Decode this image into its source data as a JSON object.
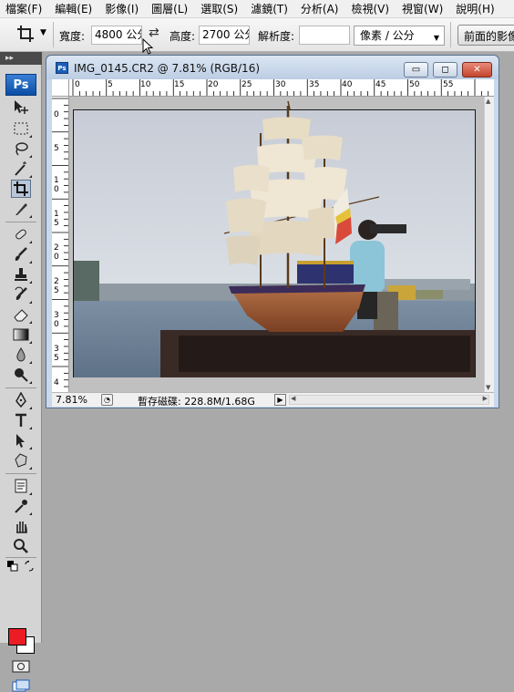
{
  "menubar": {
    "items": [
      "檔案(F)",
      "編輯(E)",
      "影像(I)",
      "圖層(L)",
      "選取(S)",
      "濾鏡(T)",
      "分析(A)",
      "檢視(V)",
      "視窗(W)",
      "說明(H)"
    ]
  },
  "options": {
    "width_label": "寬度:",
    "width_value": "4800 公分",
    "height_label": "高度:",
    "height_value": "2700 公分",
    "resolution_label": "解析度:",
    "resolution_value": "",
    "unit_select": "像素 / 公分",
    "front_image_button": "前面的影像"
  },
  "toolbox": {
    "logo": "Ps"
  },
  "document": {
    "title": "IMG_0145.CR2 @ 7.81% (RGB/16)",
    "icon_text": "Ps",
    "ruler_top_labels": [
      "0",
      "5",
      "10",
      "15",
      "20",
      "25",
      "30",
      "35",
      "40",
      "45",
      "50",
      "55"
    ],
    "ruler_left_labels": [
      "0",
      "5",
      "1\n0",
      "1\n5",
      "2\n0",
      "2\n5",
      "3\n0",
      "3\n5",
      "4"
    ],
    "status_zoom": "7.81%",
    "status_info": "暫存磁碟: 228.8M/1.68G"
  },
  "colors": {
    "foreground": "#ec1c24",
    "background": "#ffffff",
    "accent": "#1c5fb8"
  }
}
